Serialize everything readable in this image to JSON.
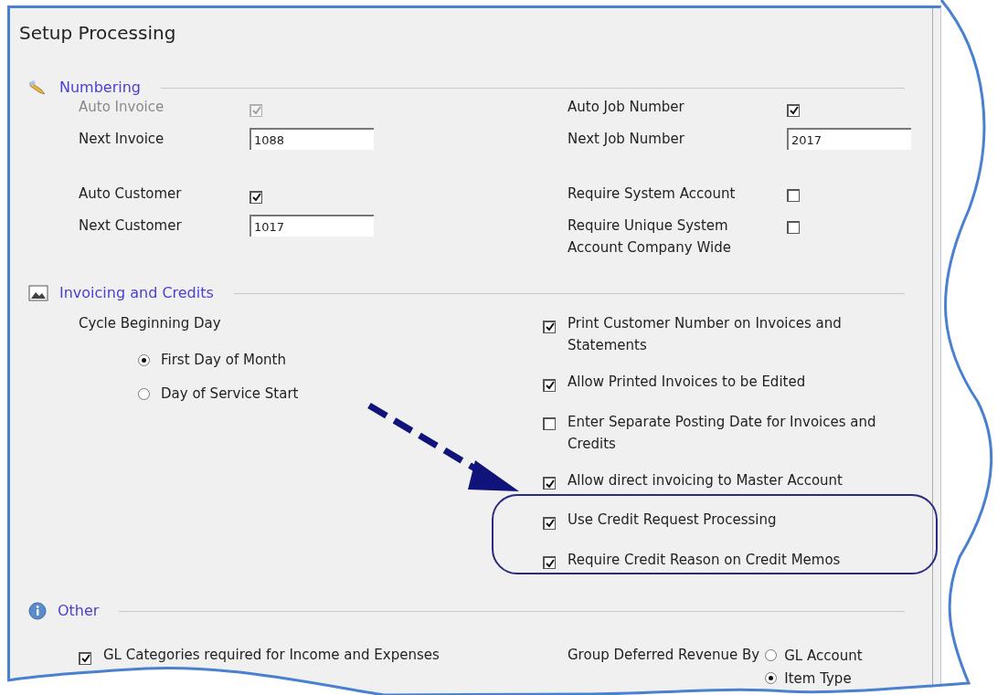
{
  "title": "Setup Processing",
  "numbering": {
    "heading": "Numbering",
    "left": [
      [
        {
          "kind": "checkbox",
          "label": "Auto Invoice",
          "checked": true,
          "disabled": true
        },
        {
          "kind": "field",
          "label": "Next Invoice",
          "value": "1088"
        }
      ],
      [
        {
          "kind": "checkbox",
          "label": "Auto Customer",
          "checked": true,
          "disabled": false
        },
        {
          "kind": "field",
          "label": "Next Customer",
          "value": "1017"
        }
      ]
    ],
    "right": [
      [
        {
          "kind": "checkbox",
          "label": "Auto Job Number",
          "checked": true,
          "disabled": false
        },
        {
          "kind": "field",
          "label": "Next Job Number",
          "value": "2017"
        }
      ],
      [
        {
          "kind": "checkbox",
          "label": "Require System Account",
          "checked": false,
          "disabled": false
        },
        {
          "kind": "checkbox",
          "label": "Require Unique System Account Company Wide",
          "checked": false,
          "disabled": false
        }
      ]
    ]
  },
  "invoicing": {
    "heading": "Invoicing and Credits",
    "cycle_label": "Cycle Beginning Day",
    "cycle_options": [
      {
        "label": "First Day of Month",
        "selected": true
      },
      {
        "label": "Day of Service Start",
        "selected": false
      }
    ],
    "options": [
      {
        "label": "Print Customer Number on Invoices and Statements",
        "checked": true
      },
      {
        "label": "Allow Printed Invoices to be Edited",
        "checked": true
      },
      {
        "label": "Enter Separate Posting Date for Invoices and Credits",
        "checked": false
      },
      {
        "label": "Allow direct invoicing to Master Account",
        "checked": true
      },
      {
        "label": "Use Credit Request Processing",
        "checked": true
      },
      {
        "label": "Require Credit Reason on Credit Memos",
        "checked": true
      }
    ]
  },
  "other": {
    "heading": "Other",
    "options": [
      {
        "label": "GL Categories required for Income and Expenses",
        "checked": true
      }
    ],
    "group_label": "Group Deferred Revenue By",
    "group_options": [
      {
        "label": "GL Account",
        "selected": false
      },
      {
        "label": "Item Type",
        "selected": true
      }
    ]
  }
}
